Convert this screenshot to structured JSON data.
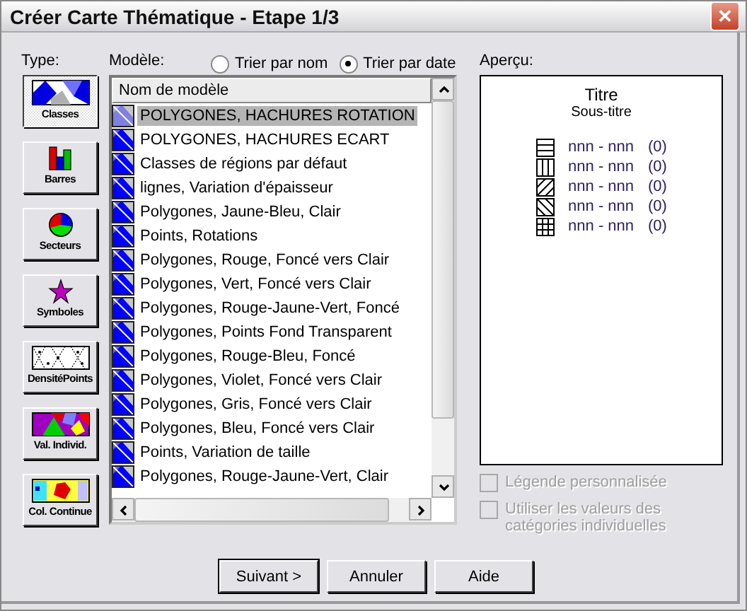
{
  "window": {
    "title": "Créer Carte Thématique - Etape 1/3",
    "close": "✕"
  },
  "type_label": "Type:",
  "types": [
    {
      "label": "Classes",
      "kind": "classes",
      "selected": true
    },
    {
      "label": "Barres",
      "kind": "bars",
      "selected": false
    },
    {
      "label": "Secteurs",
      "kind": "pie",
      "selected": false
    },
    {
      "label": "Symboles",
      "kind": "star",
      "selected": false
    },
    {
      "label": "DensitéPoints",
      "kind": "dots",
      "selected": false
    },
    {
      "label": "Val. Individ.",
      "kind": "individual",
      "selected": false
    },
    {
      "label": "Col. Continue",
      "kind": "continuous",
      "selected": false
    }
  ],
  "model_label": "Modèle:",
  "sort": [
    {
      "label": "Trier par nom",
      "selected": false
    },
    {
      "label": "Trier par date",
      "selected": true
    }
  ],
  "models": {
    "column": "Nom de modèle",
    "rows": [
      {
        "name": "POLYGONES, HACHURES ROTATION",
        "selected": true
      },
      {
        "name": "POLYGONES, HACHURES ECART",
        "selected": false
      },
      {
        "name": "Classes de régions par défaut",
        "selected": false
      },
      {
        "name": "lignes, Variation d'épaisseur",
        "selected": false
      },
      {
        "name": "Polygones, Jaune-Bleu, Clair",
        "selected": false
      },
      {
        "name": "Points, Rotations",
        "selected": false
      },
      {
        "name": "Polygones, Rouge, Foncé vers Clair",
        "selected": false
      },
      {
        "name": "Polygones, Vert, Foncé vers Clair",
        "selected": false
      },
      {
        "name": "Polygones, Rouge-Jaune-Vert, Foncé",
        "selected": false
      },
      {
        "name": "Polygones, Points Fond Transparent",
        "selected": false
      },
      {
        "name": "Polygones, Rouge-Bleu, Foncé",
        "selected": false
      },
      {
        "name": "Polygones, Violet, Foncé vers Clair",
        "selected": false
      },
      {
        "name": "Polygones, Gris, Foncé vers Clair",
        "selected": false
      },
      {
        "name": "Polygones, Bleu, Foncé vers Clair",
        "selected": false
      },
      {
        "name": "Points, Variation de taille",
        "selected": false
      },
      {
        "name": "Polygones, Rouge-Jaune-Vert, Clair",
        "selected": false
      }
    ]
  },
  "preview": {
    "label": "Aperçu:",
    "title": "Titre",
    "subtitle": "Sous-titre",
    "legend": [
      {
        "kind": "horizontal",
        "range": "nnn - nnn",
        "count": "(0)"
      },
      {
        "kind": "vertical",
        "range": "nnn - nnn",
        "count": "(0)"
      },
      {
        "kind": "diagonal",
        "range": "nnn - nnn",
        "count": "(0)"
      },
      {
        "kind": "backdiagonal",
        "range": "nnn - nnn",
        "count": "(0)"
      },
      {
        "kind": "grid",
        "range": "nnn - nnn",
        "count": "(0)"
      }
    ]
  },
  "options": [
    {
      "label": "Légende personnalisée",
      "checked": false,
      "disabled": true
    },
    {
      "label": "Utiliser les valeurs des catégories individuelles",
      "checked": false,
      "disabled": true
    }
  ],
  "buttons": [
    {
      "label": "Suivant >",
      "default": true
    },
    {
      "label": "Annuler",
      "default": false
    },
    {
      "label": "Aide",
      "default": false
    }
  ]
}
